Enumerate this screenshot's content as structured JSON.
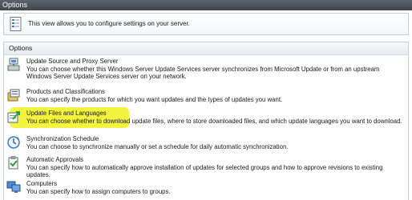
{
  "window": {
    "title": "Options"
  },
  "description": {
    "text": "This view allows you to configure settings on your server.",
    "icon": "settings-page-icon"
  },
  "section": {
    "header": "Options",
    "items": [
      {
        "title": "Update Source and Proxy Server",
        "description": "You can choose whether this Windows Server Update Services server synchronizes from Microsoft Update or from an upstream Windows Server Update Services server on your network.",
        "icon": "update-source-icon"
      },
      {
        "title": "Products and Classifications",
        "description": "You can specify the products for which you want updates and the types of updates you want.",
        "icon": "products-icon"
      },
      {
        "title": "Update Files and Languages",
        "description": "You can choose whether to download update files, where to store downloaded files, and which update languages you want to download.",
        "icon": "update-files-icon",
        "highlighted": true
      },
      {
        "title": "Synchronization Schedule",
        "description": "You can choose to synchronize manually or set a schedule for daily automatic synchronization.",
        "icon": "sync-schedule-icon"
      },
      {
        "title": "Automatic Approvals",
        "description": "You can specify how to automatically approve installation of updates for selected groups and how to approve revisions to existing updates.",
        "icon": "automatic-approvals-icon"
      },
      {
        "title": "Computers",
        "description": "You can specify how to assign computers to groups.",
        "icon": "computers-icon"
      }
    ]
  },
  "colors": {
    "titlebar": "#4a525a",
    "highlight": "#f2f230"
  }
}
